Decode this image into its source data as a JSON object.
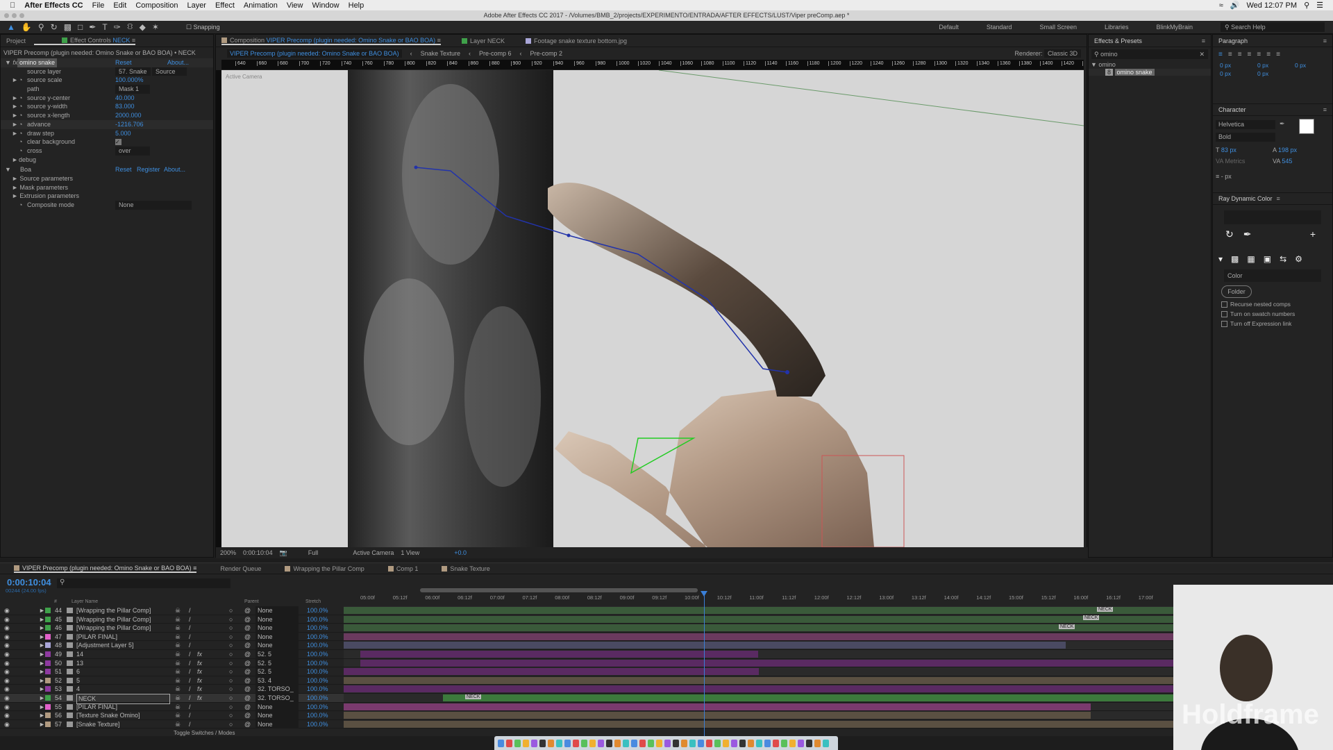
{
  "menubar": {
    "app": "After Effects CC",
    "items": [
      "File",
      "Edit",
      "Composition",
      "Layer",
      "Effect",
      "Animation",
      "View",
      "Window",
      "Help"
    ],
    "clock": "Wed 12:07 PM"
  },
  "titlebar": {
    "title": "Adobe After Effects CC 2017 - /Volumes/BMB_2/projects/EXPERIMENTO/ENTRADA/AFTER EFFECTS/LUST/Viper preComp.aep *"
  },
  "toolbar": {
    "snapping": "Snapping",
    "workspaces": [
      "Default",
      "Standard",
      "Small Screen",
      "Libraries",
      "BlinkMyBrain"
    ],
    "search_help": "Search Help"
  },
  "left_panel": {
    "tabs": {
      "project": "Project",
      "effect_controls": "Effect Controls",
      "layer": "NECK"
    },
    "header": "VIPER Precomp (plugin needed: Omino Snake or BAO BOA) • NECK",
    "effect1": {
      "name": "omino snake",
      "reset": "Reset",
      "about": "About...",
      "params": [
        {
          "label": "source layer",
          "value": "57. Snake",
          "value2": "Source",
          "type": "dropdown"
        },
        {
          "label": "source scale",
          "value": "100.000%",
          "type": "number"
        },
        {
          "label": "path",
          "value": "Mask 1",
          "type": "dropdown"
        },
        {
          "label": "source y-center",
          "value": "40.000",
          "type": "number"
        },
        {
          "label": "source y-width",
          "value": "83.000",
          "type": "number"
        },
        {
          "label": "source x-length",
          "value": "2000.000",
          "type": "number"
        },
        {
          "label": "advance",
          "value": "-1216.706",
          "type": "number"
        },
        {
          "label": "draw step",
          "value": "5.000",
          "type": "number"
        },
        {
          "label": "clear background",
          "value": "",
          "type": "checkbox",
          "checked": true
        },
        {
          "label": "cross",
          "value": "over",
          "type": "dropdown"
        },
        {
          "label": "debug",
          "value": "",
          "type": "group"
        }
      ]
    },
    "effect2": {
      "name": "Boa",
      "reset": "Reset",
      "register": "Register",
      "about": "About...",
      "params": [
        {
          "label": "Source parameters"
        },
        {
          "label": "Mask parameters"
        },
        {
          "label": "Extrusion parameters"
        },
        {
          "label": "Composite mode",
          "value": "None"
        }
      ]
    }
  },
  "comp_panel": {
    "tabs": [
      {
        "prefix": "Composition",
        "name": "VIPER Precomp (plugin needed: Omino Snake or BAO BOA)"
      },
      {
        "name": "Layer NECK"
      },
      {
        "name": "Footage snake texture bottom.jpg"
      }
    ],
    "breadcrumb": [
      "VIPER Precomp (plugin needed: Omino Snake or BAO BOA)",
      "Snake Texture",
      "Pre-comp 6",
      "Pre-comp 2"
    ],
    "renderer_label": "Renderer:",
    "renderer": "Classic 3D",
    "view_label": "Active Camera",
    "ruler": [
      "640",
      "660",
      "680",
      "700",
      "720",
      "740",
      "760",
      "780",
      "800",
      "820",
      "840",
      "860",
      "880",
      "900",
      "920",
      "940",
      "960",
      "980",
      "1000",
      "1020",
      "1040",
      "1060",
      "1080",
      "1100",
      "1120",
      "1140",
      "1160",
      "1180",
      "1200",
      "1220",
      "1240",
      "1260",
      "1280",
      "1300",
      "1320",
      "1340",
      "1360",
      "1380",
      "1400",
      "1420",
      "1440"
    ],
    "bottom": {
      "zoom": "200%",
      "timecode": "0:00:10:04",
      "resolution": "Full",
      "camera": "Active Camera",
      "views": "1 View",
      "exposure": "+0.0"
    }
  },
  "effects_presets": {
    "title": "Effects & Presets",
    "search": "omino",
    "folder": "omino",
    "item": "omino snake"
  },
  "paragraph": {
    "title": "Paragraph",
    "values": [
      "0 px",
      "0 px",
      "0 px",
      "0 px",
      "0 px"
    ]
  },
  "character": {
    "title": "Character",
    "font": "Helvetica",
    "style": "Bold",
    "size": "83 px",
    "leading": "198 px",
    "kerning": "Metrics",
    "tracking": "545",
    "stroke": "- px",
    "fill_color": "#ffffff"
  },
  "ray_dynamic_color": {
    "title": "Ray Dynamic Color",
    "dropdown": "Color",
    "folder": "Folder",
    "checks": [
      "Recurse nested comps",
      "Turn on swatch numbers",
      "Turn off Expression link"
    ]
  },
  "timeline": {
    "tabs": [
      "VIPER Precomp (plugin needed: Omino Snake or BAO BOA)",
      "Render Queue",
      "Wrapping the Pillar Comp",
      "Comp 1",
      "Snake Texture"
    ],
    "timecode": "0:00:10:04",
    "frames": "00244 (24.00 fps)",
    "headers": {
      "num": "#",
      "name": "Layer Name",
      "parent": "Parent",
      "stretch": "Stretch"
    },
    "toggle": "Toggle Switches / Modes",
    "ruler": [
      "05:00f",
      "05:12f",
      "06:00f",
      "06:12f",
      "07:00f",
      "07:12f",
      "08:00f",
      "08:12f",
      "09:00f",
      "09:12f",
      "10:00f",
      "10:12f",
      "11:00f",
      "11:12f",
      "12:00f",
      "12:12f",
      "13:00f",
      "13:12f",
      "14:00f",
      "14:12f",
      "15:00f",
      "15:12f",
      "16:00f",
      "16:12f",
      "17:00f"
    ],
    "layers": [
      {
        "num": "44",
        "name": "[Wrapping the Pillar Comp]",
        "label": "#3fa14a",
        "parent": "None",
        "stretch": "100.0%",
        "fx": false
      },
      {
        "num": "45",
        "name": "[Wrapping the Pillar Comp]",
        "label": "#3fa14a",
        "parent": "None",
        "stretch": "100.0%",
        "fx": false
      },
      {
        "num": "46",
        "name": "[Wrapping the Pillar Comp]",
        "label": "#3fa14a",
        "parent": "None",
        "stretch": "100.0%",
        "fx": false
      },
      {
        "num": "47",
        "name": "[PILAR FINAL]",
        "label": "#e060c8",
        "parent": "None",
        "stretch": "100.0%",
        "fx": false
      },
      {
        "num": "48",
        "name": "[Adjustment Layer 5]",
        "label": "#a9a6d8",
        "parent": "None",
        "stretch": "100.0%",
        "fx": false
      },
      {
        "num": "49",
        "name": "14",
        "label": "#8e3aa0",
        "parent": "52. 5",
        "stretch": "100.0%",
        "fx": true
      },
      {
        "num": "50",
        "name": "13",
        "label": "#8e3aa0",
        "parent": "52. 5",
        "stretch": "100.0%",
        "fx": true
      },
      {
        "num": "51",
        "name": "6",
        "label": "#8e3aa0",
        "parent": "52. 5",
        "stretch": "100.0%",
        "fx": true
      },
      {
        "num": "52",
        "name": "5",
        "label": "#b09a80",
        "parent": "53. 4",
        "stretch": "100.0%",
        "fx": true
      },
      {
        "num": "53",
        "name": "4",
        "label": "#8e3aa0",
        "parent": "32. TORSO_",
        "stretch": "100.0%",
        "fx": true
      },
      {
        "num": "54",
        "name": "NECK",
        "label": "#3fa14a",
        "parent": "32. TORSO_",
        "stretch": "100.0%",
        "fx": true,
        "selected": true
      },
      {
        "num": "55",
        "name": "[PILAR FINAL]",
        "label": "#e060c8",
        "parent": "None",
        "stretch": "100.0%",
        "fx": false
      },
      {
        "num": "56",
        "name": "[Texture Snake Omino]",
        "label": "#b09a80",
        "parent": "None",
        "stretch": "100.0%",
        "fx": false
      },
      {
        "num": "57",
        "name": "[Snake Texture]",
        "label": "#b09a80",
        "parent": "None",
        "stretch": "100.0%",
        "fx": false
      }
    ],
    "markers": [
      "NECK",
      "NECK",
      "NECK",
      "NECK"
    ]
  },
  "accent": "#3f8fe0",
  "watermark": "Holdframe"
}
